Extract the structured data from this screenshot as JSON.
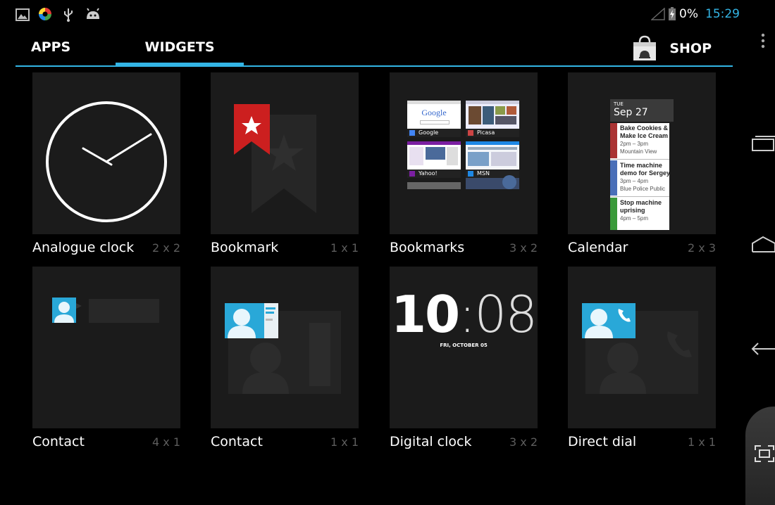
{
  "status": {
    "battery": "0%",
    "time": "15:29",
    "icons": [
      "gallery-icon",
      "sync-icon",
      "usb-icon",
      "android-icon",
      "signal-icon",
      "battery-charging-icon"
    ]
  },
  "tabs": [
    {
      "label": "APPS",
      "active": false
    },
    {
      "label": "WIDGETS",
      "active": true
    }
  ],
  "shop": {
    "label": "SHOP",
    "icon": "play-store-bag-icon"
  },
  "widgets": [
    {
      "name": "Analogue clock",
      "size": "2 x 2"
    },
    {
      "name": "Bookmark",
      "size": "1 x 1"
    },
    {
      "name": "Bookmarks",
      "size": "3 x 2"
    },
    {
      "name": "Calendar",
      "size": "2 x 3"
    },
    {
      "name": "Contact",
      "size": "4 x 1"
    },
    {
      "name": "Contact",
      "size": "1 x 1"
    },
    {
      "name": "Digital clock",
      "size": "3 x 2"
    },
    {
      "name": "Direct dial",
      "size": "1 x 1"
    }
  ],
  "previews": {
    "bookmarks": [
      {
        "title": "Google",
        "label": "Google"
      },
      {
        "label": "Picasa"
      },
      {
        "label": "Yahoo!"
      },
      {
        "label": "MSN"
      }
    ],
    "calendar": {
      "day": "TUE",
      "date": "Sep 27",
      "events": [
        {
          "title1": "Bake Cookies &",
          "title2": "Make Ice Cream",
          "time": "2pm – 3pm",
          "place": "Mountain View"
        },
        {
          "title1": "Time machine",
          "title2": "demo for Sergey",
          "time": "3pm – 4pm",
          "place": "Blue Police Public"
        },
        {
          "title1": "Stop machine",
          "title2": "uprising",
          "time": "4pm – 5pm",
          "place": ""
        }
      ]
    },
    "digital_clock": {
      "hours": "10",
      "minutes": ":08",
      "date": "FRI, OCTOBER 05"
    }
  },
  "colors": {
    "accent": "#33b5e5",
    "bookmark_red": "#cc1f1f",
    "contact_blue": "#29a8d8"
  }
}
